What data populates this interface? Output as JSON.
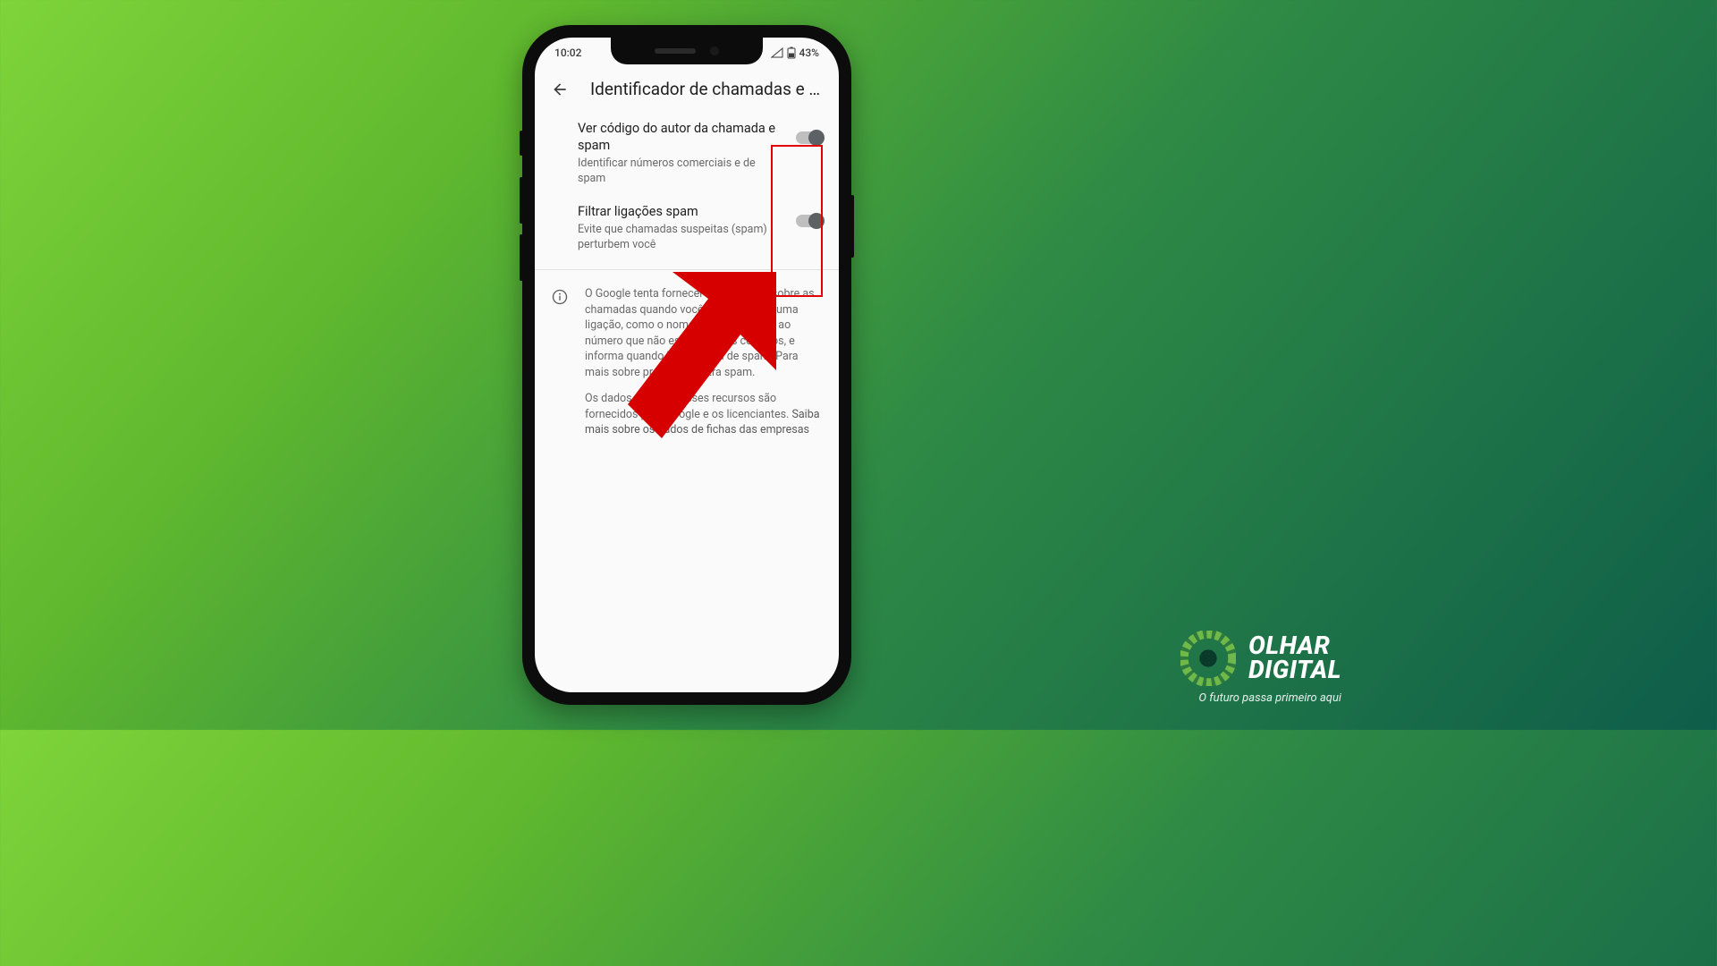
{
  "status_bar": {
    "time": "10:02",
    "battery_pct": "43%"
  },
  "app_bar": {
    "title": "Identificador de chamadas e sp..."
  },
  "settings": [
    {
      "title": "Ver código do autor da chamada e spam",
      "subtitle": "Identificar números comerciais e de spam"
    },
    {
      "title": "Filtrar ligações spam",
      "subtitle": "Evite que chamadas suspeitas (spam) perturbem você"
    }
  ],
  "info": {
    "p1": "O Google tenta fornecer informações sobre as chamadas quando você faz ou recebe uma ligação, como o nome correspondente ao número que não está nos seus contatos, e informa quando há suspeita de spam. Para mais sobre proteção contra spam.",
    "p2_prefix": "Os dados usados nesses recursos são fornecidos pelo Google e os licenciantes. ",
    "p2_link": "Saiba mais sobre os dados de fichas das empresas"
  },
  "watermark": {
    "line1": "OLHAR",
    "line2": "DIGITAL",
    "tagline": "O futuro passa primeiro aqui"
  }
}
